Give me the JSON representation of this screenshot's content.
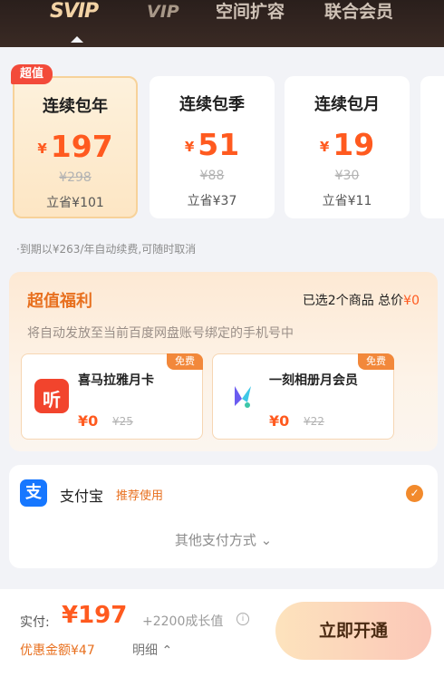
{
  "tabs": [
    {
      "label": "SVIP"
    },
    {
      "label": "VIP"
    },
    {
      "label": "空间扩容"
    },
    {
      "label": "联合会员"
    }
  ],
  "plans": [
    {
      "badge": "超值",
      "title": "连续包年",
      "currency": "¥",
      "price": "197",
      "original": "¥298",
      "save": "立省¥101"
    },
    {
      "title": "连续包季",
      "currency": "¥",
      "price": "51",
      "original": "¥88",
      "save": "立省¥37"
    },
    {
      "title": "连续包月",
      "currency": "¥",
      "price": "19",
      "original": "¥30",
      "save": "立省¥11"
    }
  ],
  "auto_renew_note": "·到期以¥263/年自动续费,可随时取消",
  "benefits": {
    "title": "超值福利",
    "summary_prefix": "已选2个商品 总价",
    "summary_amount": "¥0",
    "description": "将自动发放至当前百度网盘账号绑定的手机号中",
    "gifts": [
      {
        "free": "免费",
        "name": "喜马拉雅月卡",
        "price": "¥0",
        "original": "¥25",
        "icon": "ximalaya-icon"
      },
      {
        "free": "免费",
        "name": "一刻相册月会员",
        "price": "¥0",
        "original": "¥22",
        "icon": "yike-album-icon"
      }
    ]
  },
  "payment": {
    "method": "支付宝",
    "tag": "推荐使用",
    "other": "其他支付方式"
  },
  "bottom": {
    "real_label": "实付:",
    "real_amount": "¥197",
    "growth": "+2200成长值",
    "discount": "优惠金额¥47",
    "detail": "明细",
    "pay_button": "立即开通"
  },
  "colors": {
    "accent": "#ff5a1f",
    "header_bg": "#2a1f1c",
    "alipay": "#1677ff",
    "ximalaya": "#f2442d"
  }
}
